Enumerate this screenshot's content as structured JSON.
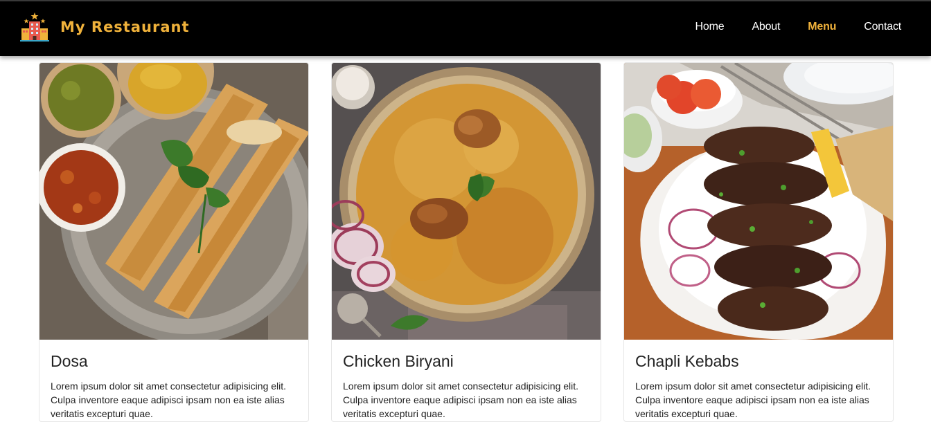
{
  "brand": {
    "name": "My Restaurant",
    "logo_icon": "restaurant-building-icon",
    "accent": "#f0b23b"
  },
  "nav": {
    "items": [
      {
        "label": "Home",
        "active": false
      },
      {
        "label": "About",
        "active": false
      },
      {
        "label": "Menu",
        "active": true
      },
      {
        "label": "Contact",
        "active": false
      }
    ]
  },
  "cards": [
    {
      "title": "Dosa",
      "text": "Lorem ipsum dolor sit amet consectetur adipisicing elit. Culpa inventore eaque adipisci ipsam non ea iste alias veritatis excepturi quae.",
      "image_icon": "dosa-plate-image"
    },
    {
      "title": "Chicken Biryani",
      "text": "Lorem ipsum dolor sit amet consectetur adipisicing elit. Culpa inventore eaque adipisci ipsam non ea iste alias veritatis excepturi quae.",
      "image_icon": "biryani-plate-image"
    },
    {
      "title": "Chapli Kebabs",
      "text": "Lorem ipsum dolor sit amet consectetur adipisicing elit. Culpa inventore eaque adipisci ipsam non ea iste alias veritatis excepturi quae.",
      "image_icon": "kebab-plate-image"
    }
  ]
}
